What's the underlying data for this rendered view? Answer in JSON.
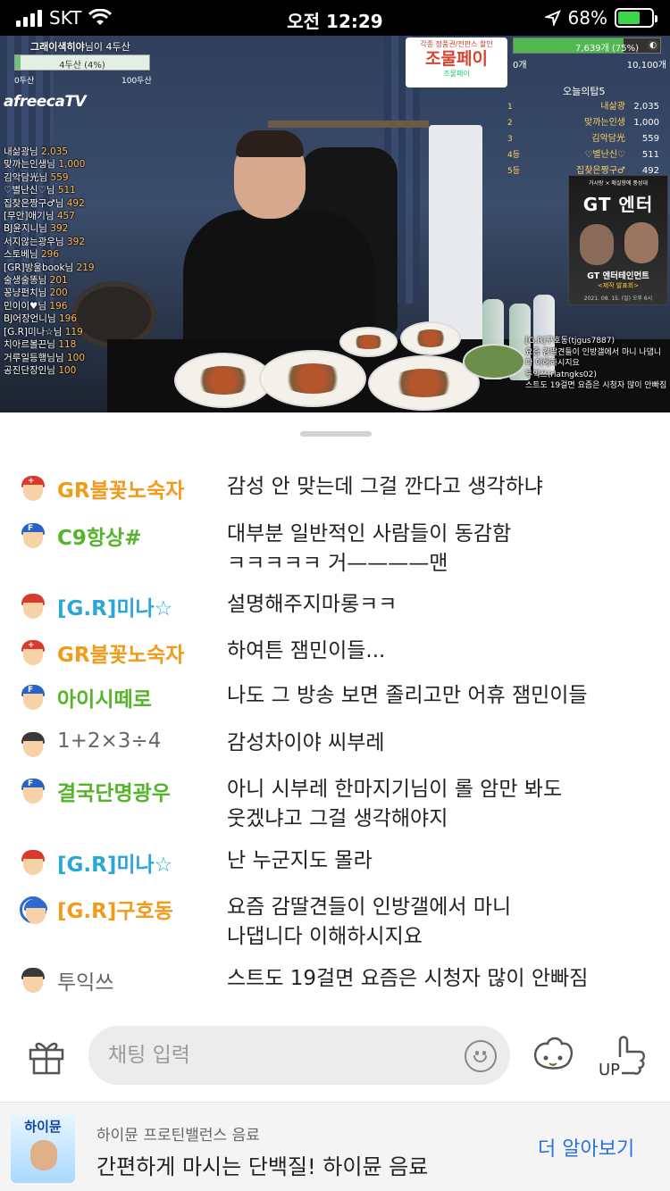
{
  "status_bar": {
    "carrier": "SKT",
    "time": "오전 12:29",
    "battery_percent": "68%",
    "battery_level": 0.68
  },
  "stream_overlay": {
    "gift_goal_label": "그래이색히야",
    "gift_goal_suffix": "님이 4두산",
    "gift_goal_progress_text": "4두산 (4%)",
    "gift_goal_fraction": 0.04,
    "gift_goal_min": "0두산",
    "gift_goal_max": "100두산",
    "platform_logo": "afreecaTV",
    "donors": [
      {
        "name": "내삶광님",
        "amount": "2,035"
      },
      {
        "name": "맞까는인생님",
        "amount": "1,000"
      },
      {
        "name": "김악담光님",
        "amount": "559"
      },
      {
        "name": "♡별난신♡님",
        "amount": "511"
      },
      {
        "name": "집찾은짱구♂님",
        "amount": "492"
      },
      {
        "name": "[무안]애기님",
        "amount": "457"
      },
      {
        "name": "BJ윤지니님",
        "amount": "392"
      },
      {
        "name": "서지않는광우님",
        "amount": "392"
      },
      {
        "name": "스토베님",
        "amount": "296"
      },
      {
        "name": "[GR]방울book님",
        "amount": "219"
      },
      {
        "name": "술생술똥님",
        "amount": "201"
      },
      {
        "name": "꽁냥펀치님",
        "amount": "200"
      },
      {
        "name": "민이이♥님",
        "amount": "196"
      },
      {
        "name": "BJ어장언니님",
        "amount": "196"
      },
      {
        "name": "[G.R]미나☆님",
        "amount": "119"
      },
      {
        "name": "치아르볼끈님",
        "amount": "118"
      },
      {
        "name": "거루일등행님님",
        "amount": "100"
      },
      {
        "name": "공진단장인님",
        "amount": "100"
      }
    ],
    "ad_top": "각종 정품권/전판스 할인",
    "ad_main": "조물페이",
    "ad_sub": "조물페이",
    "goal_bar_text": "7,639개 (75%)",
    "goal_bar_fraction": 0.75,
    "goal_bar_min": "0개",
    "goal_bar_max": "10,100개",
    "top5_title": "오늘의탑5",
    "top5": [
      {
        "rank": "1",
        "name": "내삶광",
        "count": "2,035"
      },
      {
        "rank": "2",
        "name": "맞까는인생",
        "count": "1,000"
      },
      {
        "rank": "3",
        "name": "김악담光",
        "count": "559"
      },
      {
        "rank": "4등",
        "name": "♡별난신♡",
        "count": "511"
      },
      {
        "rank": "5등",
        "name": "집찾은짱구♂",
        "count": "492"
      }
    ],
    "poster_top": "거시랑 × 매실향에 풍성대",
    "poster_title": "GT 엔터",
    "poster_name": "GT 엔터테인먼트",
    "poster_sub": "<제작 발표회>",
    "poster_date": "2021. 08. 15. (일) 오후 6시",
    "overlay_chat": [
      {
        "user": "[G.R]구호동(tjgus7887)",
        "text": "요즘 감딸견들이 인방갤에서 마니 나댑니다 이해하시지요"
      },
      {
        "user": "투익쓰(rlatngks02)",
        "text": "스트도 19걸면 요즘은 시청자 많이 안빠짐"
      }
    ]
  },
  "chat": {
    "messages": [
      {
        "nick": "GR불꽃노숙자",
        "nick_color": "#f29a1a",
        "avatar": "red-cross-avatar",
        "lines": [
          "감성 안 맞는데 그걸 깐다고 생각하냐"
        ]
      },
      {
        "nick": "C9항상#",
        "nick_color": "#55b52a",
        "avatar": "fan-f-avatar",
        "lines": [
          "대부분 일반적인 사람들이 동감함",
          "ㅋㅋㅋㅋㅋ 거————맨"
        ]
      },
      {
        "nick": "[G.R]미나☆",
        "nick_color": "#2aa7d8",
        "avatar": "red-cap-avatar",
        "lines": [
          "설명해주지마롱ㅋㅋ"
        ]
      },
      {
        "nick": "GR불꽃노숙자",
        "nick_color": "#f29a1a",
        "avatar": "red-cross-avatar",
        "lines": [
          "하여튼 잼민이들..."
        ]
      },
      {
        "nick": "아이시떼로",
        "nick_color": "#55b52a",
        "avatar": "fan-f-avatar",
        "lines": [
          "나도 그 방송 보면 졸리고만 어휴 잼민이들"
        ]
      },
      {
        "nick": "1+2×3÷4",
        "nick_color": "#666666",
        "avatar": "default-avatar",
        "lines": [
          "감성차이야 씨부레"
        ]
      },
      {
        "nick": "결국단명광우",
        "nick_color": "#55b52a",
        "avatar": "fan-f-avatar",
        "lines": [
          "아니 시부레 한마지기님이 롤 암만 봐도",
          "웃겠냐고 그걸 생각해야지"
        ]
      },
      {
        "nick": "[G.R]미나☆",
        "nick_color": "#2aa7d8",
        "avatar": "red-cap-avatar",
        "lines": [
          "난 누군지도 몰라"
        ]
      },
      {
        "nick": "[G.R]구호동",
        "nick_color": "#f29a1a",
        "avatar": "ring-avatar",
        "lines": [
          "요즘 감딸견들이 인방갤에서 마니",
          "나댑니다 이해하시지요"
        ]
      },
      {
        "nick": "투익쓰",
        "nick_color": "#666666",
        "avatar": "default-avatar",
        "lines": [
          "스트도 19걸면 요즘은 시청자 많이 안빠짐"
        ]
      }
    ]
  },
  "input_bar": {
    "placeholder": "채팅 입력",
    "gift_icon": "gift-icon",
    "emoji_icon": "emoji-icon",
    "balloon_icon": "star-balloon-icon",
    "up_label": "UP"
  },
  "ad_banner": {
    "logo_text": "하이뮨",
    "small_text": "하이뮨 프로틴밸런스 음료",
    "big_text": "간편하게 마시는 단백질! 하이뮨 음료",
    "link_text": "더 알아보기"
  }
}
